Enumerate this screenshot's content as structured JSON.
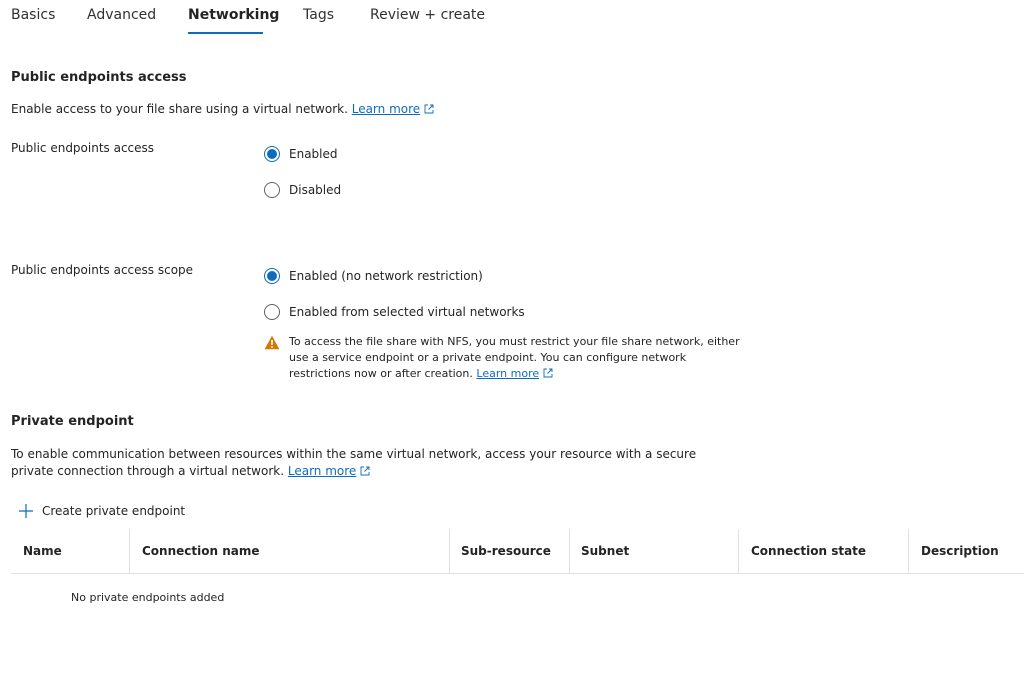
{
  "tabs": [
    {
      "label": "Basics"
    },
    {
      "label": "Advanced"
    },
    {
      "label": "Networking",
      "active": true
    },
    {
      "label": "Tags"
    },
    {
      "label": "Review + create"
    }
  ],
  "public": {
    "title": "Public endpoints access",
    "description": "Enable access to your file share using a virtual network.",
    "learn_more": "Learn more",
    "access_label": "Public endpoints access",
    "access_options": [
      "Enabled",
      "Disabled"
    ],
    "access_selected": "Enabled",
    "scope_label": "Public endpoints access scope",
    "scope_options": [
      "Enabled (no network restriction)",
      "Enabled from selected virtual networks"
    ],
    "scope_selected": "Enabled (no network restriction)",
    "warning_text": "To access the file share with NFS, you must restrict your file share network, either use a service endpoint or a private endpoint. You can configure network restrictions now or after creation.",
    "warning_learn_more": "Learn more"
  },
  "private": {
    "title": "Private endpoint",
    "description": "To enable communication between resources within the same virtual network, access your resource with a secure private connection through a virtual network.",
    "learn_more": "Learn more",
    "create_button": "Create private endpoint",
    "columns": [
      "Name",
      "Connection name",
      "Sub-resource",
      "Subnet",
      "Connection state",
      "Description"
    ],
    "empty_message": "No private endpoints added"
  },
  "colors": {
    "accent": "#0f6cbd",
    "warning": "#d47a00",
    "text": "#242424"
  },
  "icons": {
    "external_link": "external-link-icon",
    "warning": "warning-icon",
    "plus": "plus-icon"
  }
}
